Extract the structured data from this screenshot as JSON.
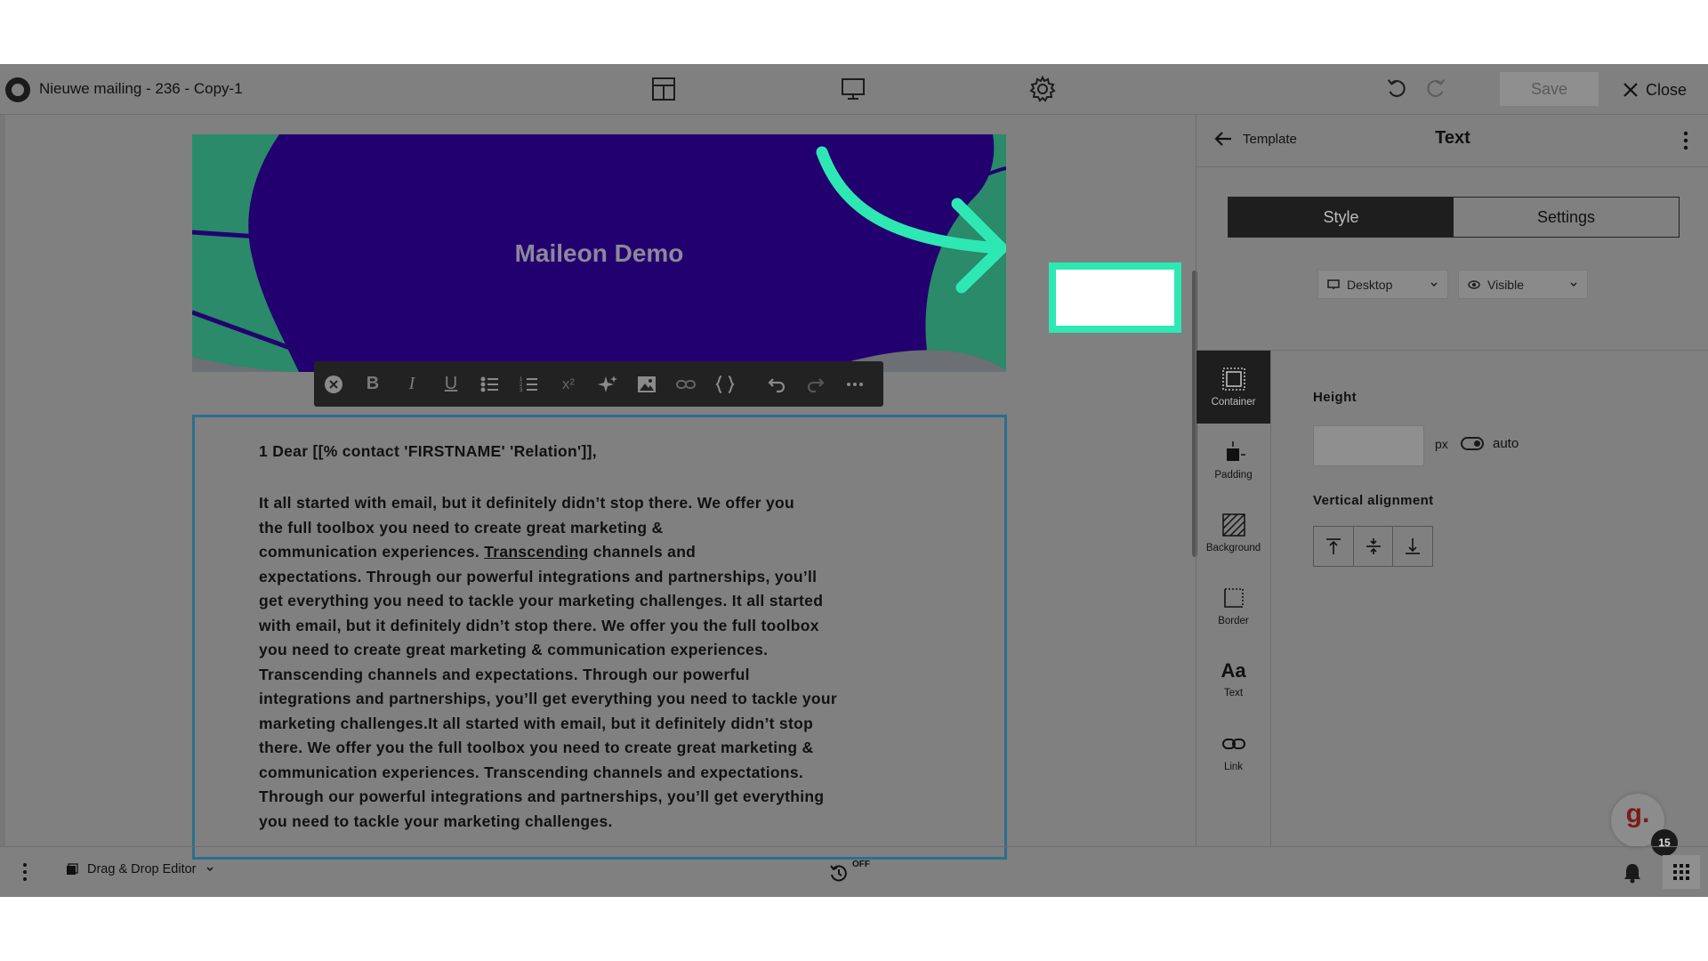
{
  "header": {
    "title": "Nieuwe mailing - 236 - Copy-1",
    "save_label": "Save",
    "close_label": "Close"
  },
  "canvas": {
    "hero_title": "Maileon Demo",
    "greeting": "1 Dear [[% contact 'FIRSTNAME' 'Relation']],",
    "body_lines": [
      "It all started with email, but it definitely didn’t stop there. We offer you",
      "the full toolbox you need to create great marketing &",
      "communication experiences. ",
      "expectations. Through our powerful integrations and partnerships, you’ll",
      "get everything you need to tackle your marketing challenges.  It all started",
      "with email, but it definitely didn’t stop there. We offer you the full toolbox",
      "you need to create great marketing & communication experiences.",
      "Transcending channels and expectations. Through our powerful",
      "integrations and partnerships, you’ll get everything you need to tackle your",
      "marketing challenges.It all started with email, but it definitely didn’t stop",
      "there. We offer you the full toolbox you need to create great marketing &",
      "communication experiences. Transcending channels and expectations.",
      "Through our powerful integrations and partnerships, you’ll get everything",
      "you need to tackle your marketing challenges."
    ],
    "link_word": "Transcending",
    "line3_tail": " channels and"
  },
  "toolbar": {
    "superscript": "x²",
    "items": [
      "close",
      "bold",
      "italic",
      "underline",
      "bullet-list",
      "numbered-list",
      "superscript",
      "ai-sparkle",
      "image",
      "link",
      "code-braces",
      "undo",
      "redo",
      "more"
    ]
  },
  "panel": {
    "back_label": "Template",
    "title": "Text",
    "tabs": [
      "Style",
      "Settings"
    ],
    "device_select": "Desktop",
    "visibility_select": "Visible",
    "sidebar": [
      "Container",
      "Padding",
      "Background",
      "Border",
      "Text",
      "Link"
    ],
    "text_icon_glyph": "Aa",
    "height_label": "Height",
    "height_unit": "px",
    "auto_label": "auto",
    "valign_label": "Vertical alignment"
  },
  "bottom": {
    "editor_mode": "Drag & Drop Editor",
    "autosave_state": "OFF",
    "notification_count": "15",
    "assistant_letter": "g."
  },
  "colors": {
    "hero_bg": "#230070",
    "accent_annotation": "#2ee8b4",
    "leaf_green": "#2a8a6a",
    "selection_border": "#2d6e8f"
  }
}
